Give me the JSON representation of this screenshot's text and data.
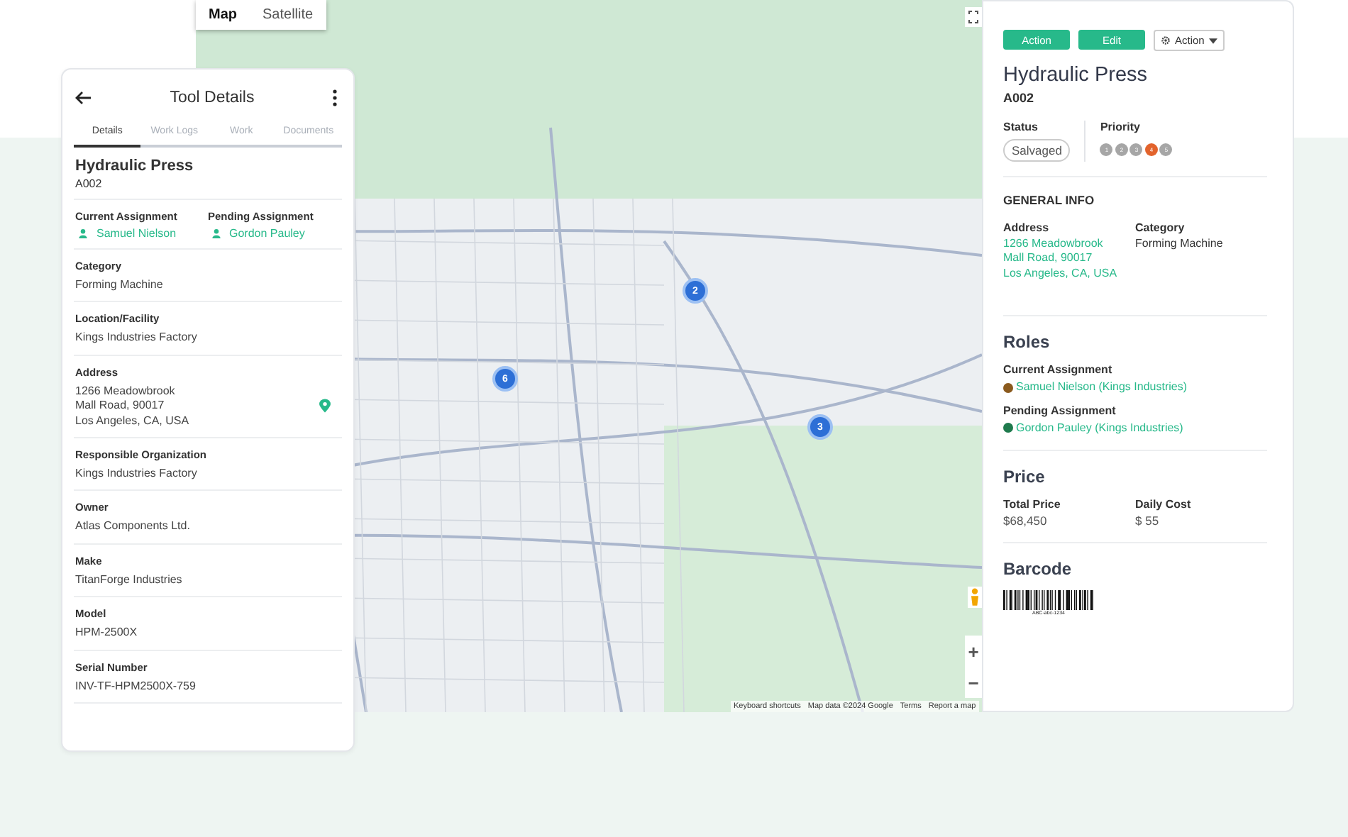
{
  "map": {
    "view_toggle": [
      {
        "label": "Map",
        "selected": true
      },
      {
        "label": "Satellite",
        "selected": false
      }
    ],
    "clusters": [
      {
        "count": "2"
      },
      {
        "count": "6"
      },
      {
        "count": "3"
      }
    ],
    "zoom": [
      "+",
      "−"
    ],
    "attribution": [
      "Keyboard shortcuts",
      "Map data ©2024 Google",
      "Terms",
      "Report a map"
    ]
  },
  "tool_card": {
    "title": "Tool Details",
    "tabs": [
      {
        "label": "Details",
        "selected": true
      },
      {
        "label": "Work Logs",
        "selected": false
      },
      {
        "label": "Work",
        "selected": false
      },
      {
        "label": "Documents",
        "selected": false
      }
    ],
    "name": "Hydraulic Press",
    "code": "A002",
    "assignments": [
      {
        "label": "Current Assignment",
        "person": "Samuel Nielson"
      },
      {
        "label": "Pending Assignment",
        "person": "Gordon Pauley"
      }
    ],
    "fields": [
      {
        "kind": "text",
        "label": "Category",
        "lines": [
          "Forming Machine"
        ]
      },
      {
        "kind": "text",
        "label": "Location/Facility",
        "lines": [
          "Kings Industries Factory"
        ]
      },
      {
        "kind": "address",
        "label": "Address",
        "lines": [
          "1266 Meadowbrook",
          "Mall Road, 90017",
          "Los Angeles, CA, USA"
        ]
      },
      {
        "kind": "text",
        "label": "Responsible Organization",
        "lines": [
          "Kings Industries Factory"
        ]
      },
      {
        "kind": "text",
        "label": "Owner",
        "lines": [
          "Atlas Components Ltd."
        ]
      },
      {
        "kind": "text",
        "label": "Make",
        "lines": [
          "TitanForge Industries"
        ]
      },
      {
        "kind": "text",
        "label": "Model",
        "lines": [
          "HPM-2500X"
        ]
      },
      {
        "kind": "text",
        "label": "Serial Number",
        "lines": [
          "INV-TF-HPM2500X-759"
        ]
      }
    ]
  },
  "detail_panel": {
    "buttons": [
      {
        "kind": "primary",
        "label": "Action"
      },
      {
        "kind": "primary",
        "label": "Edit"
      },
      {
        "kind": "menu",
        "label": "Action"
      }
    ],
    "name": "Hydraulic Press",
    "code": "A002",
    "status": {
      "label": "Status",
      "value": "Salvaged"
    },
    "priority": {
      "label": "Priority",
      "levels": [
        {
          "label": "1",
          "selected": false
        },
        {
          "label": "2",
          "selected": false
        },
        {
          "label": "3",
          "selected": false
        },
        {
          "label": "4",
          "selected": true
        },
        {
          "label": "5",
          "selected": false
        }
      ]
    },
    "general_info": {
      "heading": "GENERAL INFO",
      "address_label": "Address",
      "address_lines": [
        "1266 Meadowbrook",
        "Mall Road, 90017",
        "Los Angeles, CA, USA"
      ],
      "category_label": "Category",
      "category": "Forming Machine"
    },
    "roles": {
      "heading": "Roles",
      "items": [
        {
          "label": "Current Assignment",
          "person": "Samuel Nielson (Kings Industries)",
          "color": "#8b5a1e"
        },
        {
          "label": "Pending Assignment",
          "person": "Gordon Pauley (Kings Industries)",
          "color": "#1f7a4d"
        }
      ]
    },
    "price": {
      "heading": "Price",
      "items": [
        {
          "label": "Total Price",
          "value": "$68,450"
        },
        {
          "label": "Daily Cost",
          "value": "$ 55"
        }
      ]
    },
    "barcode": {
      "heading": "Barcode",
      "text": "ABC-abc-1234"
    }
  }
}
